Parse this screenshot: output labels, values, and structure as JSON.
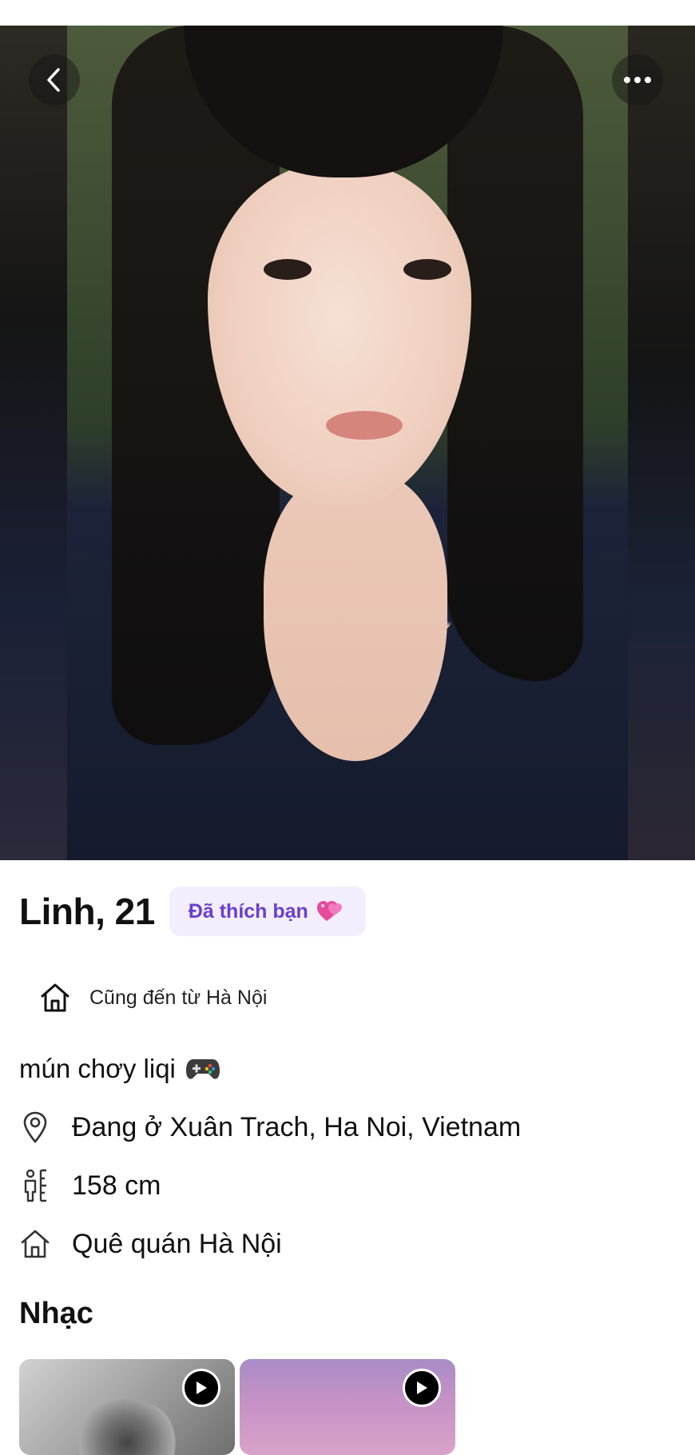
{
  "profile": {
    "name_age": "Linh, 21",
    "liked_badge": "Đã thích bạn",
    "hometown_chip": "Cũng đến từ Hà Nội",
    "bio": "mún chơy liqi",
    "details": [
      {
        "icon": "location-pin-icon",
        "text": "Đang ở Xuân Trach, Ha Noi, Vietnam"
      },
      {
        "icon": "height-icon",
        "text": "158 cm"
      },
      {
        "icon": "home-icon",
        "text": "Quê quán Hà Nội"
      }
    ]
  },
  "music": {
    "title": "Nhạc"
  },
  "icons": {
    "back": "chevron-left-icon",
    "more": "more-horizontal-icon",
    "badge_emoji": "heart-emoji-icon",
    "bio_emoji": "game-controller-icon"
  },
  "colors": {
    "badge_bg": "#f3eefd",
    "badge_text": "#6a3fd2"
  }
}
